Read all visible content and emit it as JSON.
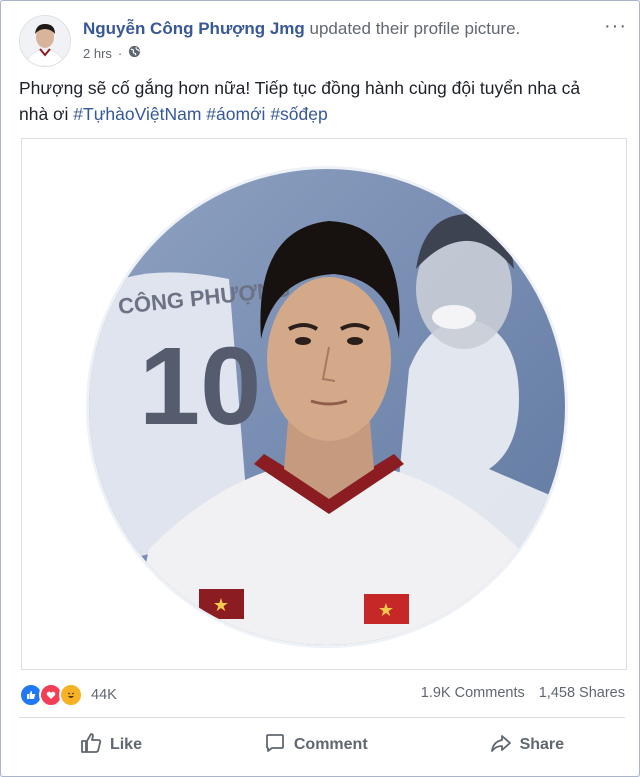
{
  "post": {
    "author_name": "Nguyễn Công Phượng Jmg",
    "action_text": "updated their profile picture.",
    "time": "2 hrs",
    "visibility_icon": "globe-icon",
    "more_icon": "more-options-icon",
    "text_main": "Phượng sẽ cố gắng hơn nữa! Tiếp tục đồng hành cùng đội tuyển nha cả nhà ơi ",
    "hashtags": [
      "#TựhàoViệtNam",
      "#áomới",
      "#sốđẹp"
    ],
    "jersey_text": "CÔNG PHƯỢNG",
    "jersey_number": "10"
  },
  "stats": {
    "reaction_icons": [
      "like-icon",
      "love-icon",
      "haha-icon"
    ],
    "reaction_count": "44K",
    "comments": "1.9K Comments",
    "shares": "1,458 Shares"
  },
  "actions": {
    "like": "Like",
    "comment": "Comment",
    "share": "Share"
  },
  "colors": {
    "link_blue": "#385898",
    "like_blue": "#2078f4",
    "love_red": "#f33e58",
    "haha_yellow": "#f7b125",
    "jersey_maroon": "#8a1c22"
  }
}
